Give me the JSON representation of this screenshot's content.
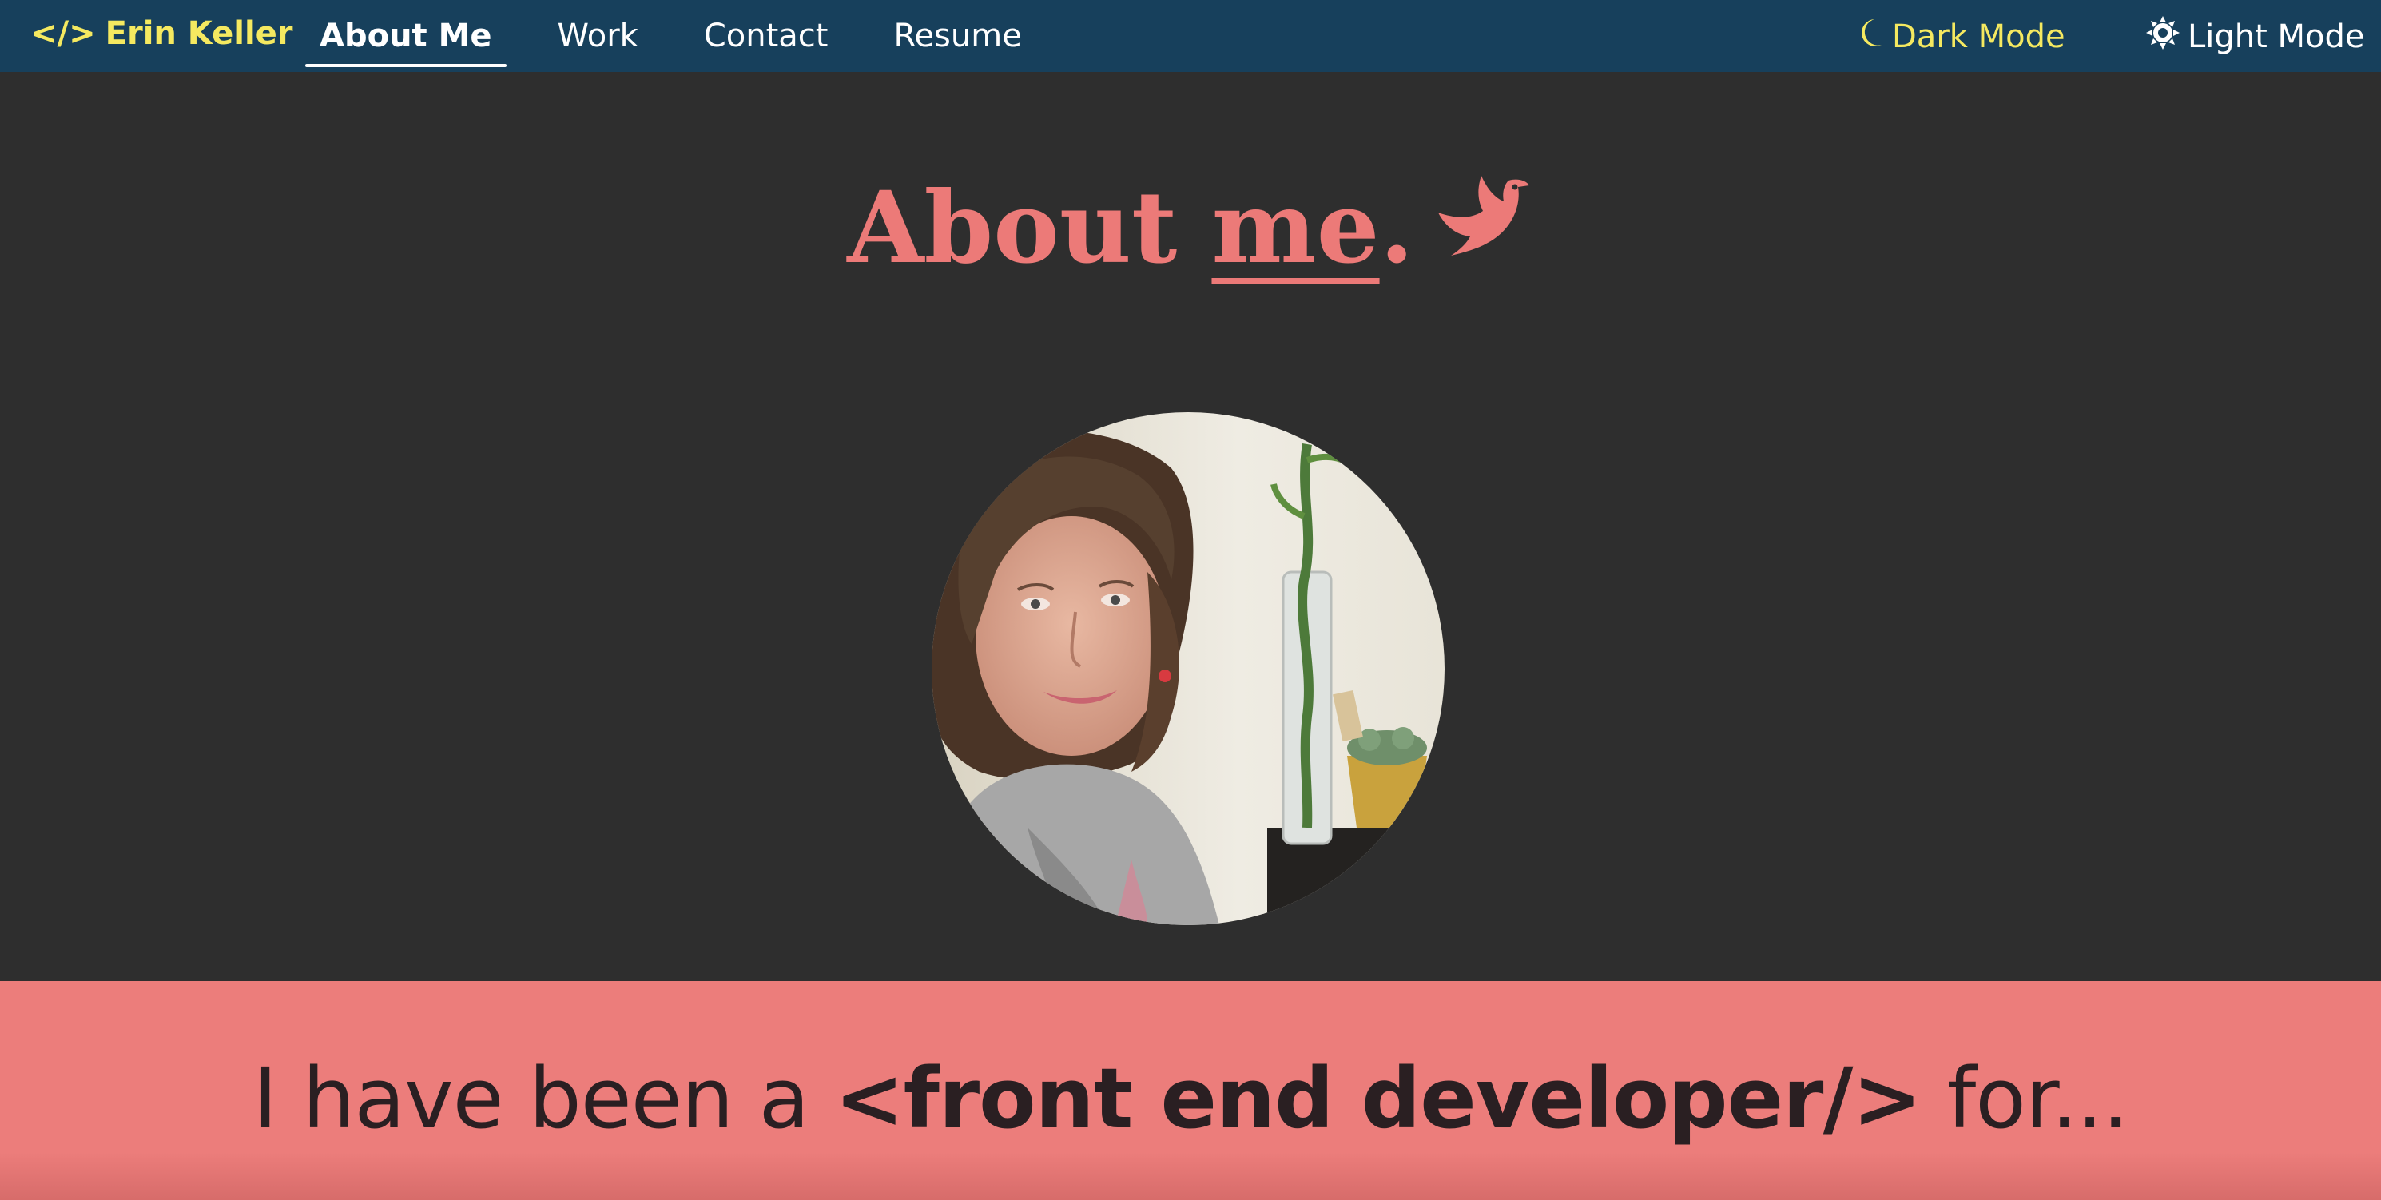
{
  "nav": {
    "brand_icon": "</>",
    "brand_name": "Erin Keller",
    "links": [
      {
        "label": "About Me",
        "active": true
      },
      {
        "label": "Work",
        "active": false
      },
      {
        "label": "Contact",
        "active": false
      },
      {
        "label": "Resume",
        "active": false
      }
    ],
    "dark_mode_label": "Dark Mode",
    "dark_mode_icon": "moon-icon",
    "light_mode_label": "Light Mode",
    "light_mode_icon": "sun-icon"
  },
  "hero": {
    "title_part1": "About ",
    "title_emphasis": "me",
    "title_part2": ".",
    "title_icon": "dove-icon",
    "photo": "portrait-photo"
  },
  "banner": {
    "text_before": "I have been a ",
    "text_highlight": "<front end developer/>",
    "text_after": " for..."
  },
  "colors": {
    "nav_bg": "#17405c",
    "page_bg": "#2e2e2e",
    "accent_coral": "#ec7a78",
    "banner_bg": "#ec7d7b",
    "brand_yellow": "#f5e960",
    "white": "#ffffff"
  }
}
